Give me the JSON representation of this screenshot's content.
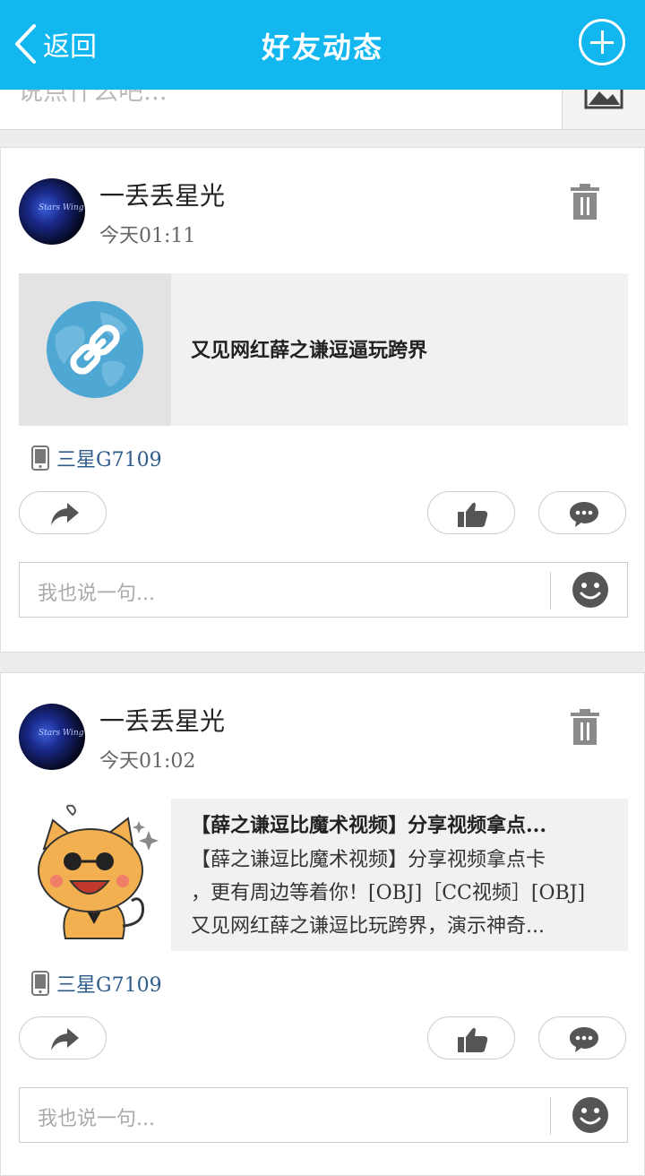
{
  "header": {
    "back_label": "返回",
    "title": "好友动态"
  },
  "compose": {
    "placeholder": "说点什么吧..."
  },
  "posts": [
    {
      "user": "一丢丢星光",
      "time": "今天01:11",
      "link_title": "又见网红薛之谦逗逼玩跨界",
      "device": "三星G7109",
      "reply_placeholder": "我也说一句..."
    },
    {
      "user": "一丢丢星光",
      "time": "今天01:02",
      "share_title": "【薛之谦逗比魔术视频】分享视频拿点...",
      "share_lines": [
        "【薛之谦逗比魔术视频】分享视频拿点卡",
        "，更有周边等着你！[OBJ]［CC视频］[OBJ]",
        "又见网红薛之谦逗比玩跨界，演示神奇..."
      ],
      "device": "三星G7109",
      "reply_placeholder": "我也说一句..."
    }
  ],
  "colors": {
    "header": "#12b7f0",
    "device_text": "#2e5c8a",
    "icon": "#555555"
  }
}
